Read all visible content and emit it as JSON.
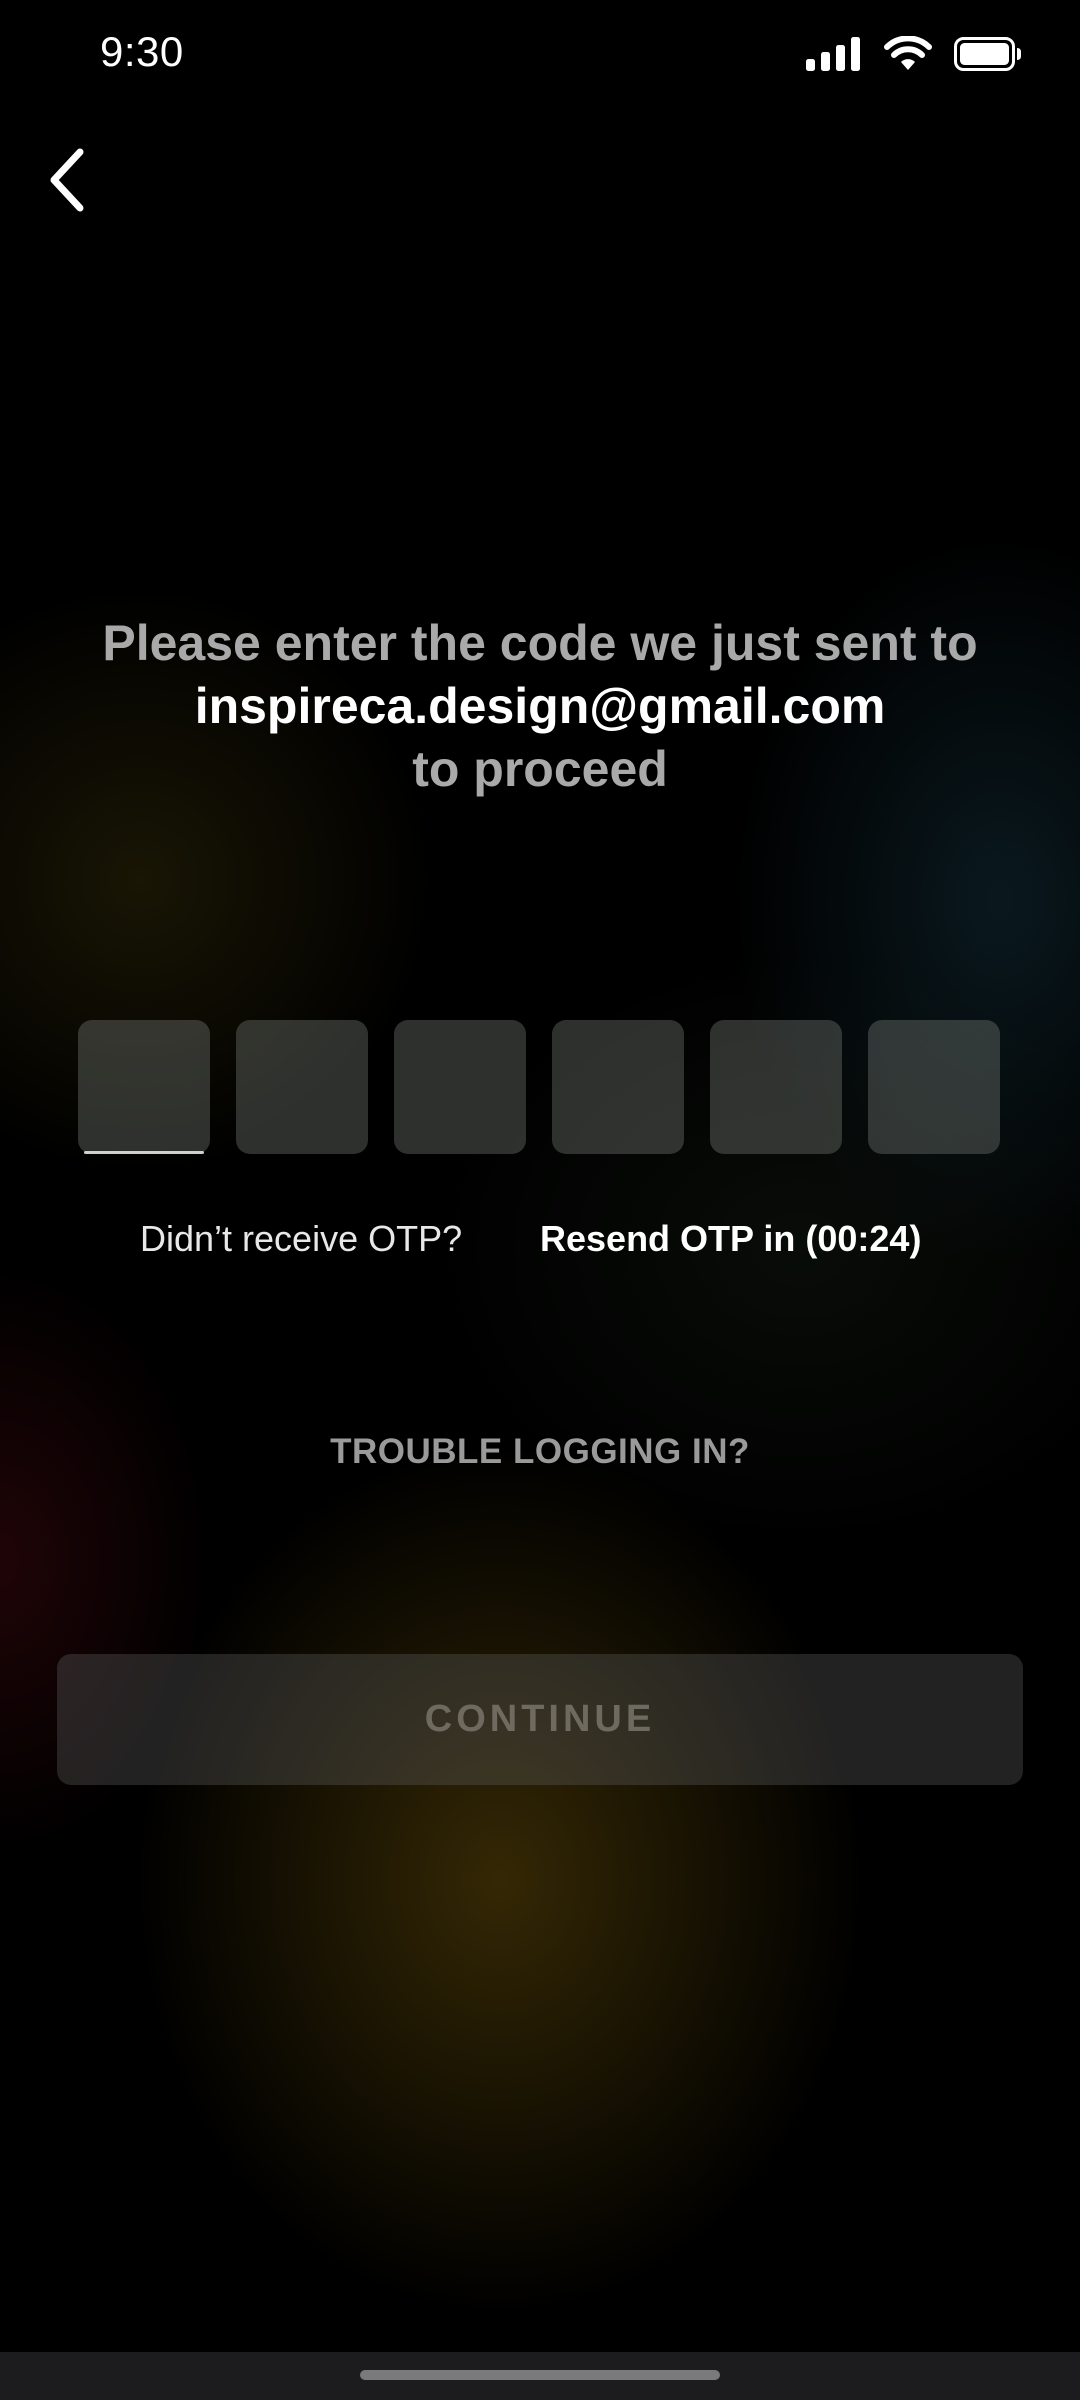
{
  "status_bar": {
    "time": "9:30",
    "icons": [
      "signal-icon",
      "wifi-icon",
      "battery-icon"
    ]
  },
  "nav": {
    "back_icon": "chevron-left-icon"
  },
  "prompt": {
    "line1": "Please enter the code we just sent to",
    "email": "inspireca.design@gmail.com",
    "line3": "to proceed"
  },
  "otp": {
    "length": 6,
    "values": [
      "",
      "",
      "",
      "",
      "",
      ""
    ],
    "active_index": 0
  },
  "resend": {
    "question": "Didn’t receive OTP?",
    "link": "Resend OTP in (00:24)"
  },
  "trouble": {
    "label": "TROUBLE LOGGING IN?"
  },
  "continue": {
    "label": "CONTINUE",
    "enabled": false
  },
  "colors": {
    "background": "#000000",
    "muted_text": "#a9a9a9",
    "disabled_label": "#6f6a60"
  }
}
